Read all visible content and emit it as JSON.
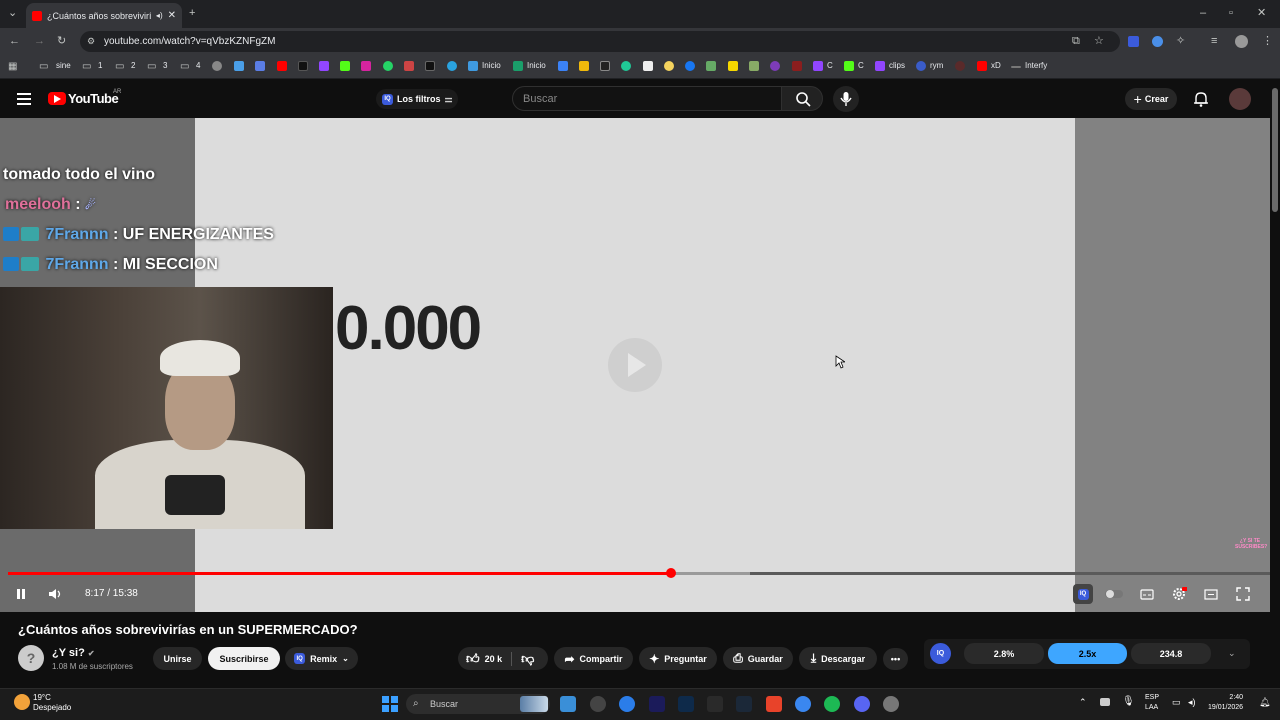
{
  "browser": {
    "tab_title": "¿Cuántos años sobrevivirías",
    "url": "youtube.com/watch?v=qVbzKZNFgZM",
    "bookmarks": [
      "sine",
      "1",
      "2",
      "3",
      "4",
      "Inicio",
      "Inicio",
      "C",
      "C",
      "clips",
      "rym",
      "xD",
      "Interfy"
    ]
  },
  "youtube": {
    "region": "AR",
    "logo_text": "YouTube",
    "filters_label": "Los filtros",
    "search_placeholder": "Buscar",
    "create_label": "Crear"
  },
  "video": {
    "chat": [
      {
        "user": "",
        "text": "tomado todo el vino"
      },
      {
        "user": "meelooh",
        "text": " : "
      },
      {
        "user": "7Frannn",
        "text": " : UF ENERGIZANTES"
      },
      {
        "user": "7Frannn",
        "text": " : MI SECCION"
      }
    ],
    "slide_text": "0.000",
    "sticker_text": "¿Y SI TE SUSCRIBES?",
    "time_current": "8:17",
    "time_total": "15:38",
    "time_display": "8:17 / 15:38",
    "progress_played": 0.525,
    "progress_buffered": 0.588
  },
  "details": {
    "title": "¿Cuántos años sobrevivirías en un SUPERMERCADO?",
    "channel_name": "¿Y si?",
    "subscribers": "1.08 M de suscriptores",
    "join_label": "Unirse",
    "subscribe_label": "Suscribirse",
    "remix_label": "Remix",
    "likes": "20 k",
    "share_label": "Compartir",
    "ask_label": "Preguntar",
    "save_label": "Guardar",
    "download_label": "Descargar",
    "ext_values": [
      "2.8%",
      "2.5x",
      "234.8"
    ]
  },
  "taskbar": {
    "temperature": "19°C",
    "weather": "Despejado",
    "search_label": "Buscar",
    "lang_line1": "ESP",
    "lang_line2": "LAA",
    "time": "2:40",
    "date": "19/01/2026"
  },
  "colors": {
    "accent_red": "#ff0000",
    "iq_blue": "#3b5bdb",
    "ext_active": "#3ea6ff"
  }
}
